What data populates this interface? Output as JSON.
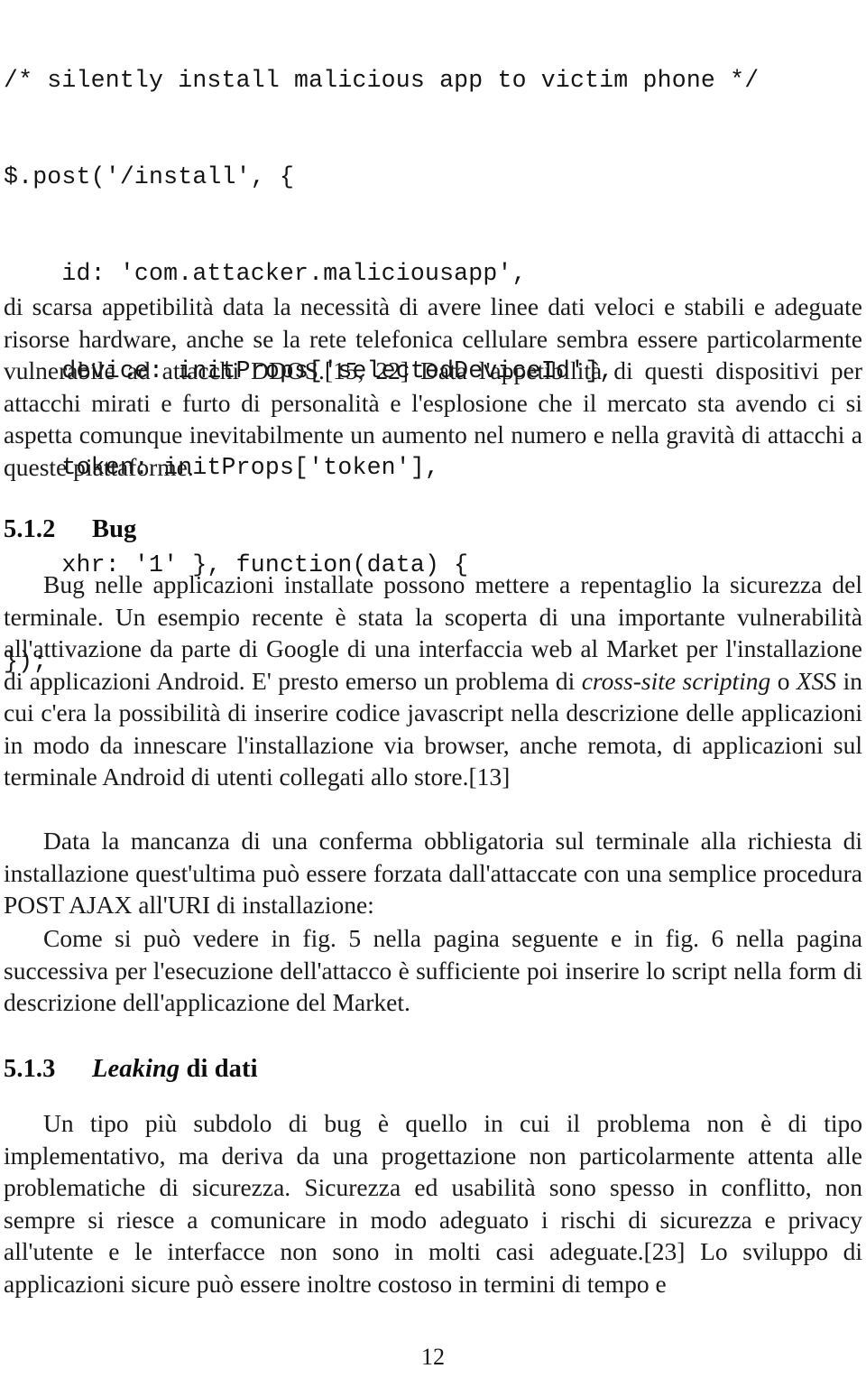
{
  "document": {
    "page_number": "12",
    "code_block": {
      "language": "javascript",
      "lines": [
        "/* silently install malicious app to victim phone */",
        "$.post('/install', {",
        "    id: 'com.attacker.maliciousapp',",
        "    device: initProps['selectedDeviceId'],",
        "    token: initProps['token'],",
        "    xhr: '1' }, function(data) {",
        "});"
      ]
    },
    "paragraphs": {
      "para_1": "di scarsa appetibilità data la necessità di avere linee dati veloci e stabili e adeguate risorse hardware, anche se la rete telefonica cellulare sembra essere particolarmente vulnerabile ad attacchi DDOS.[15, 22] Data l'appetibilità di questi dispositivi per attacchi mirati e furto di personalità e l'esplosione che il mercato sta avendo ci si aspetta comunque inevitabilmente un aumento nel numero e nella gravità di attacchi a queste piattaforme.",
      "para_2_part_1": "Bug nelle applicazioni installate possono mettere a repentaglio la sicurezza del terminale. Un esempio recente è stata la scoperta di una importante vulnerabilità all'attivazione da parte di Google di una interfaccia web al Market per l'installazione di applicazioni Android. E' presto emerso un problema di ",
      "para_2_italic_1": "cross-site scripting",
      "para_2_part_2": " o ",
      "para_2_italic_2": "XSS",
      "para_2_part_3": " in cui c'era la possibilità di inserire codice javascript nella descrizione delle applicazioni in modo da innescare l'installazione via browser, anche remota, di applicazioni sul terminale Android di utenti collegati allo store.[13]",
      "para_3": "Data la mancanza di una conferma obbligatoria sul terminale alla richiesta di installazione quest'ultima può essere forzata dall'attaccate con una semplice procedura POST AJAX all'URI di installazione:",
      "para_4": "Come si può vedere in fig. 5 nella pagina seguente e in fig. 6 nella pagina successiva per l'esecuzione dell'attacco è sufficiente poi inserire lo script nella form di descrizione dell'applicazione del Market.",
      "para_5": "Un tipo più subdolo di bug è quello in cui il problema non è di tipo implementativo, ma deriva da una progettazione non particolarmente attenta alle problematiche di sicurezza. Sicurezza ed usabilità sono spesso in conflitto, non sempre si riesce a comunicare in modo adeguato i rischi di sicurezza e privacy all'utente e le interfacce non sono in molti casi adeguate.[23] Lo sviluppo di applicazioni sicure può essere inoltre costoso in termini di tempo e"
    },
    "headings": {
      "section_512": {
        "number": "5.1.2",
        "title": "Bug"
      },
      "section_513": {
        "number": "5.1.3",
        "title_italic": "Leaking",
        "title_rest": " di dati"
      }
    }
  }
}
